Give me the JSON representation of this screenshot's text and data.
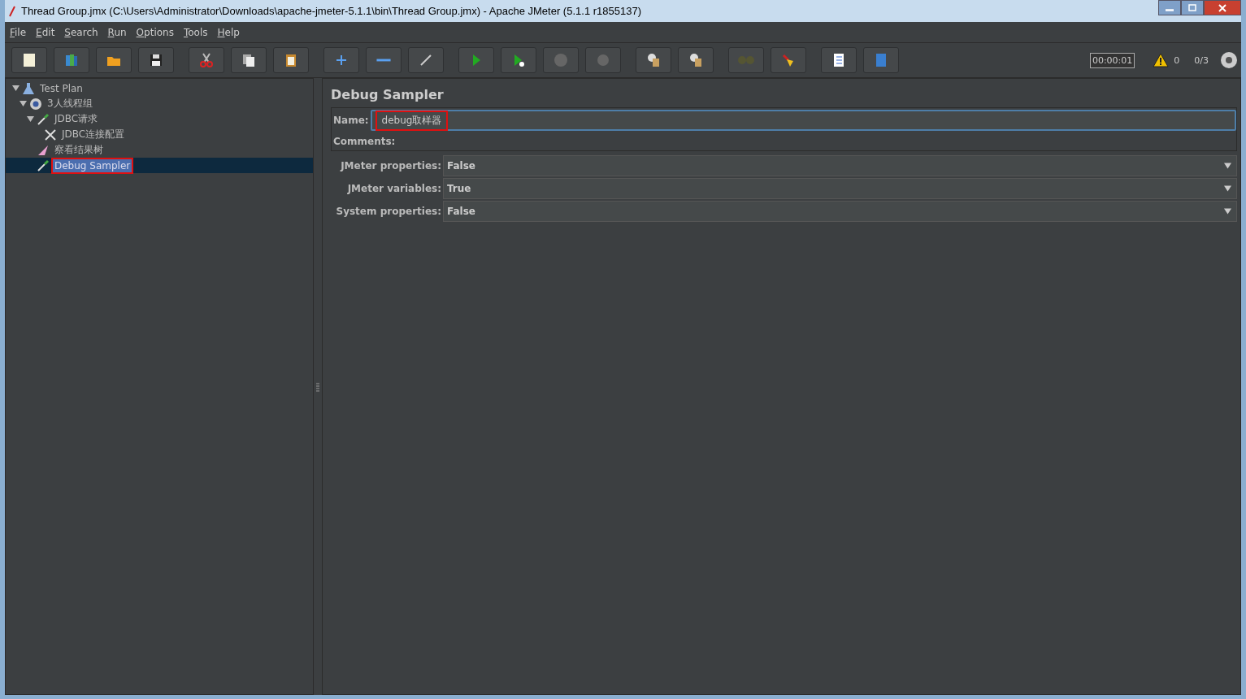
{
  "window": {
    "title": "Thread Group.jmx (C:\\Users\\Administrator\\Downloads\\apache-jmeter-5.1.1\\bin\\Thread Group.jmx) - Apache JMeter (5.1.1 r1855137)"
  },
  "menu": [
    "File",
    "Edit",
    "Search",
    "Run",
    "Options",
    "Tools",
    "Help"
  ],
  "toolbar_status": {
    "timer": "00:00:01",
    "errors": "0",
    "threads": "0/3"
  },
  "tree": [
    {
      "label": "Test Plan",
      "kind": "plan",
      "expanded": true,
      "selected": false,
      "highlighted": false,
      "children": [
        {
          "label": "3人线程组",
          "kind": "group",
          "expanded": true,
          "selected": false,
          "highlighted": false,
          "children": [
            {
              "label": "JDBC请求",
              "kind": "sampler",
              "expanded": true,
              "selected": false,
              "highlighted": false,
              "children": [
                {
                  "label": "JDBC连接配置",
                  "kind": "config",
                  "selected": false,
                  "highlighted": false
                }
              ]
            },
            {
              "label": "察看结果树",
              "kind": "listener",
              "selected": false,
              "highlighted": false
            },
            {
              "label": "Debug Sampler",
              "kind": "sampler",
              "selected": true,
              "highlighted": true
            }
          ]
        }
      ]
    }
  ],
  "panel": {
    "title": "Debug Sampler",
    "name_label": "Name:",
    "name_value": "debug取样器",
    "name_highlighted": true,
    "comments_label": "Comments:",
    "fields": [
      {
        "label": "JMeter properties:",
        "value": "False"
      },
      {
        "label": "JMeter variables:",
        "value": "True"
      },
      {
        "label": "System properties:",
        "value": "False"
      }
    ]
  }
}
